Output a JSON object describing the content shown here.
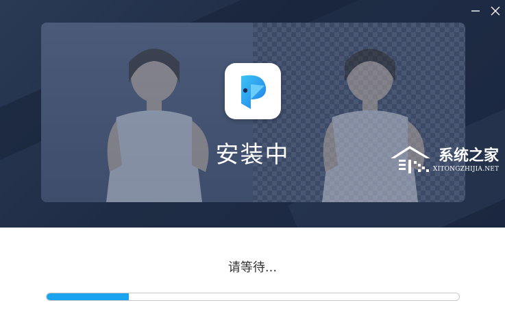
{
  "window": {
    "controls": {
      "minimize_icon": "minimize-icon",
      "close_icon": "close-icon"
    }
  },
  "banner": {
    "title": "安装中",
    "logo_icon": "app-logo-icon"
  },
  "watermark": {
    "text_cn": "系统之家",
    "text_en": "XITONGZHIJIA.NET"
  },
  "status": {
    "message": "请等待..."
  },
  "progress": {
    "value": 0.2,
    "fill_color": "#1aa3ef"
  }
}
